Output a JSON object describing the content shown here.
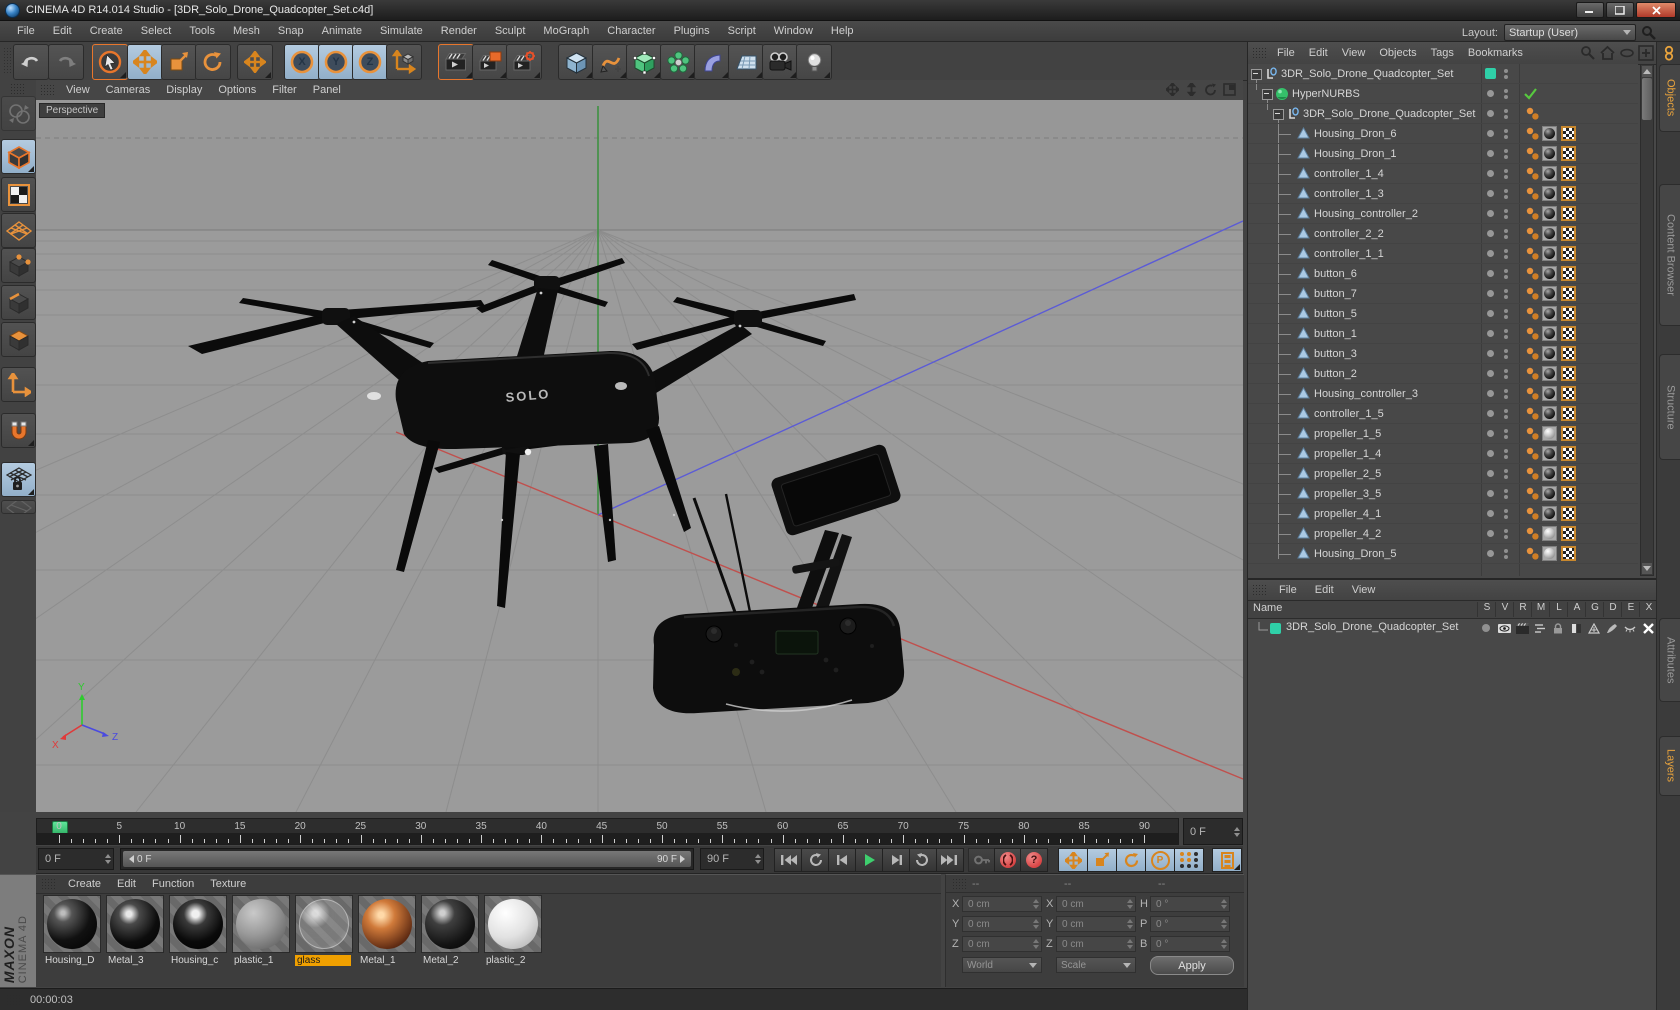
{
  "window": {
    "title": "CINEMA 4D R14.014 Studio - [3DR_Solo_Drone_Quadcopter_Set.c4d]"
  },
  "menubar": {
    "items": [
      "File",
      "Edit",
      "Create",
      "Select",
      "Tools",
      "Mesh",
      "Snap",
      "Animate",
      "Simulate",
      "Render",
      "Sculpt",
      "MoGraph",
      "Character",
      "Plugins",
      "Script",
      "Window",
      "Help"
    ],
    "layout_label": "Layout:",
    "layout_value": "Startup (User)"
  },
  "toolbar": {
    "axis_locks": [
      "X",
      "Y",
      "Z"
    ]
  },
  "viewport": {
    "menu": [
      "View",
      "Cameras",
      "Display",
      "Options",
      "Filter",
      "Panel"
    ],
    "view_label": "Perspective",
    "gizmo": {
      "x": "X",
      "y": "Y",
      "z": "Z"
    },
    "drone_text": "SOLO"
  },
  "object_manager": {
    "menu": [
      "File",
      "Edit",
      "View",
      "Objects",
      "Tags",
      "Bookmarks"
    ],
    "tree": [
      {
        "name": "3DR_Solo_Drone_Quadcopter_Set",
        "level": 0,
        "icon": "null",
        "expand": true,
        "vis": "square"
      },
      {
        "name": "HyperNURBS",
        "level": 1,
        "icon": "hypernurbs",
        "expand": true,
        "vis": "dots",
        "check": true
      },
      {
        "name": "3DR_Solo_Drone_Quadcopter_Set",
        "level": 2,
        "icon": "null",
        "expand": true,
        "vis": "dots",
        "tags": [
          "phong"
        ]
      },
      {
        "name": "Housing_Dron_6",
        "level": 3,
        "icon": "poly",
        "vis": "dots",
        "tags": [
          "phong",
          "mat",
          "uvw"
        ],
        "mat": "black"
      },
      {
        "name": "Housing_Dron_1",
        "level": 3,
        "icon": "poly",
        "vis": "dots",
        "tags": [
          "phong",
          "mat",
          "uvw"
        ],
        "mat": "black"
      },
      {
        "name": "controller_1_4",
        "level": 3,
        "icon": "poly",
        "vis": "dots",
        "tags": [
          "phong",
          "mat",
          "uvw"
        ],
        "mat": "black"
      },
      {
        "name": "controller_1_3",
        "level": 3,
        "icon": "poly",
        "vis": "dots",
        "tags": [
          "phong",
          "mat",
          "uvw"
        ],
        "mat": "black"
      },
      {
        "name": "Housing_controller_2",
        "level": 3,
        "icon": "poly",
        "vis": "dots",
        "tags": [
          "phong",
          "mat",
          "uvw"
        ],
        "mat": "black"
      },
      {
        "name": "controller_2_2",
        "level": 3,
        "icon": "poly",
        "vis": "dots",
        "tags": [
          "phong",
          "mat",
          "uvw"
        ],
        "mat": "black"
      },
      {
        "name": "controller_1_1",
        "level": 3,
        "icon": "poly",
        "vis": "dots",
        "tags": [
          "phong",
          "mat",
          "uvw"
        ],
        "mat": "black"
      },
      {
        "name": "button_6",
        "level": 3,
        "icon": "poly",
        "vis": "dots",
        "tags": [
          "phong",
          "mat",
          "uvw"
        ],
        "mat": "black"
      },
      {
        "name": "button_7",
        "level": 3,
        "icon": "poly",
        "vis": "dots",
        "tags": [
          "phong",
          "mat",
          "uvw"
        ],
        "mat": "black"
      },
      {
        "name": "button_5",
        "level": 3,
        "icon": "poly",
        "vis": "dots",
        "tags": [
          "phong",
          "mat",
          "uvw"
        ],
        "mat": "black"
      },
      {
        "name": "button_1",
        "level": 3,
        "icon": "poly",
        "vis": "dots",
        "tags": [
          "phong",
          "mat",
          "uvw"
        ],
        "mat": "black"
      },
      {
        "name": "button_3",
        "level": 3,
        "icon": "poly",
        "vis": "dots",
        "tags": [
          "phong",
          "mat",
          "uvw"
        ],
        "mat": "black"
      },
      {
        "name": "button_2",
        "level": 3,
        "icon": "poly",
        "vis": "dots",
        "tags": [
          "phong",
          "mat",
          "uvw"
        ],
        "mat": "black"
      },
      {
        "name": "Housing_controller_3",
        "level": 3,
        "icon": "poly",
        "vis": "dots",
        "tags": [
          "phong",
          "mat",
          "uvw"
        ],
        "mat": "black"
      },
      {
        "name": "controller_1_5",
        "level": 3,
        "icon": "poly",
        "vis": "dots",
        "tags": [
          "phong",
          "mat",
          "uvw"
        ],
        "mat": "black"
      },
      {
        "name": "propeller_1_5",
        "level": 3,
        "icon": "poly",
        "vis": "dots",
        "tags": [
          "phong",
          "mat",
          "uvw"
        ],
        "mat": "silver"
      },
      {
        "name": "propeller_1_4",
        "level": 3,
        "icon": "poly",
        "vis": "dots",
        "tags": [
          "phong",
          "mat",
          "uvw"
        ],
        "mat": "black"
      },
      {
        "name": "propeller_2_5",
        "level": 3,
        "icon": "poly",
        "vis": "dots",
        "tags": [
          "phong",
          "mat",
          "uvw"
        ],
        "mat": "black"
      },
      {
        "name": "propeller_3_5",
        "level": 3,
        "icon": "poly",
        "vis": "dots",
        "tags": [
          "phong",
          "mat",
          "uvw"
        ],
        "mat": "black"
      },
      {
        "name": "propeller_4_1",
        "level": 3,
        "icon": "poly",
        "vis": "dots",
        "tags": [
          "phong",
          "mat",
          "uvw"
        ],
        "mat": "black"
      },
      {
        "name": "propeller_4_2",
        "level": 3,
        "icon": "poly",
        "vis": "dots",
        "tags": [
          "phong",
          "mat",
          "uvw"
        ],
        "mat": "silver"
      },
      {
        "name": "Housing_Dron_5",
        "level": 3,
        "icon": "poly",
        "vis": "dots",
        "tags": [
          "phong",
          "mat",
          "uvw"
        ],
        "mat": "silver"
      }
    ]
  },
  "layer_manager": {
    "menu": [
      "File",
      "Edit",
      "View"
    ],
    "name_header": "Name",
    "columns": [
      "S",
      "V",
      "R",
      "M",
      "L",
      "A",
      "G",
      "D",
      "E",
      "X"
    ],
    "row_name": "3DR_Solo_Drone_Quadcopter_Set"
  },
  "side_tabs": {
    "objects": "Objects",
    "content_browser": "Content Browser",
    "structure": "Structure",
    "attributes": "Attributes",
    "layers": "Layers"
  },
  "timeline": {
    "tick_labels": [
      "0",
      "5",
      "10",
      "15",
      "20",
      "25",
      "30",
      "35",
      "40",
      "45",
      "50",
      "55",
      "60",
      "65",
      "70",
      "75",
      "80",
      "85",
      "90"
    ],
    "frame_field": "0 F",
    "start_field": "0 F",
    "range_start": "0 F",
    "range_end": "90 F",
    "end_field": "90 F",
    "p_label": "P",
    "question_label": "?"
  },
  "materials": {
    "menu": [
      "Create",
      "Edit",
      "Function",
      "Texture"
    ],
    "items": [
      {
        "name": "Housing_D",
        "style": "mb-black1"
      },
      {
        "name": "Metal_3",
        "style": "mb-black2"
      },
      {
        "name": "Housing_c",
        "style": "mb-black3"
      },
      {
        "name": "plastic_1",
        "style": "mb-grey"
      },
      {
        "name": "glass",
        "style": "mb-glass",
        "selected": true
      },
      {
        "name": "Metal_1",
        "style": "mb-copper"
      },
      {
        "name": "Metal_2",
        "style": "mb-darkmetal"
      },
      {
        "name": "plastic_2",
        "style": "mb-white"
      }
    ]
  },
  "coordinates": {
    "headers": [
      "--",
      "--",
      "--"
    ],
    "groups": [
      {
        "labels": [
          "X",
          "Y",
          "Z"
        ],
        "values": [
          "0 cm",
          "0 cm",
          "0 cm"
        ]
      },
      {
        "labels": [
          "X",
          "Y",
          "Z"
        ],
        "values": [
          "0 cm",
          "0 cm",
          "0 cm"
        ]
      },
      {
        "labels": [
          "H",
          "P",
          "B"
        ],
        "values": [
          "0 °",
          "0 °",
          "0 °"
        ]
      }
    ],
    "world": "World",
    "scale_dd": "Scale",
    "apply": "Apply"
  },
  "status": {
    "time": "00:00:03"
  },
  "branding": {
    "maxon": "MAXON",
    "cinema": "CINEMA 4D"
  }
}
